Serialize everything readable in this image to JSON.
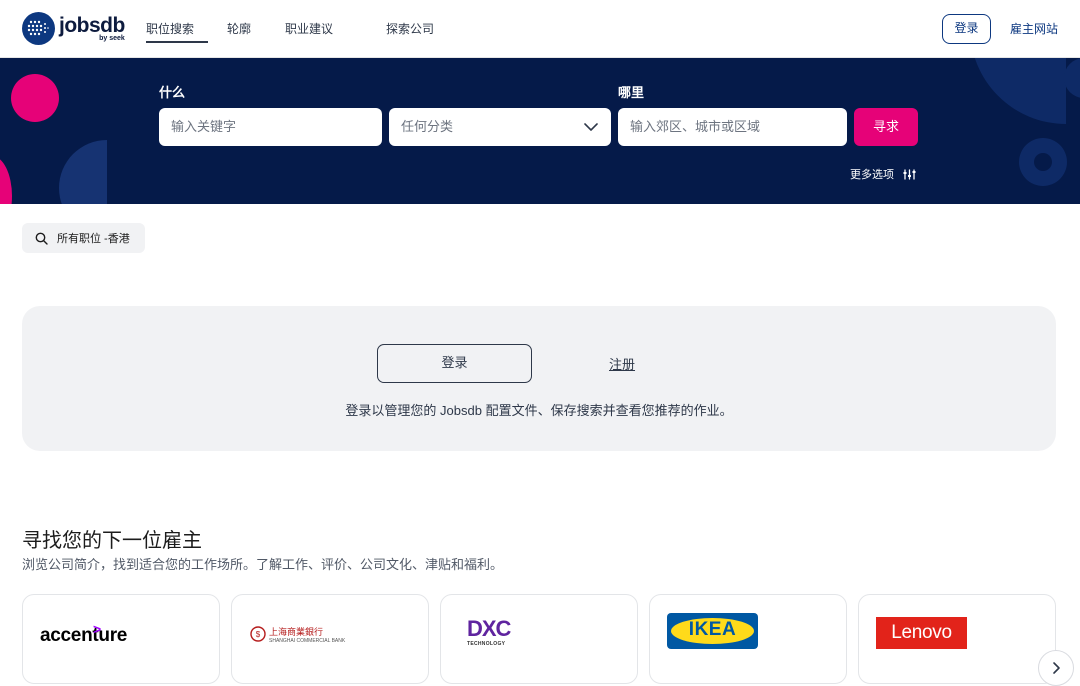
{
  "header": {
    "logo_text": "jobsdb",
    "logo_sub": "by seek",
    "nav": [
      "职位搜索",
      "轮廓",
      "职业建议",
      "探索公司"
    ],
    "login_label": "登录",
    "employer_label": "雇主网站"
  },
  "search": {
    "what_label": "什么",
    "where_label": "哪里",
    "keyword_placeholder": "输入关键字",
    "category_value": "任何分类",
    "location_placeholder": "输入郊区、城市或区域",
    "search_button": "寻求",
    "more_options": "更多选项"
  },
  "filter_chip": "所有职位 -香港",
  "login_card": {
    "login_button": "登录",
    "register_link": "注册",
    "description": "登录以管理您的 Jobsdb 配置文件、保存搜索并查看您推荐的作业。"
  },
  "employers": {
    "title": "寻找您的下一位雇主",
    "subtitle": "浏览公司简介，找到适合您的工作场所。了解工作、评价、公司文化、津贴和福利。",
    "companies": [
      {
        "name": "accenture"
      },
      {
        "name": "上海商業銀行",
        "sub": "SHANGHAI COMMERCIAL BANK"
      },
      {
        "name": "DXC",
        "sub": "TECHNOLOGY"
      },
      {
        "name": "IKEA"
      },
      {
        "name": "Lenovo"
      }
    ]
  },
  "colors": {
    "brand_navy": "#051a49",
    "accent_pink": "#e60278",
    "link_blue": "#0d3880"
  }
}
